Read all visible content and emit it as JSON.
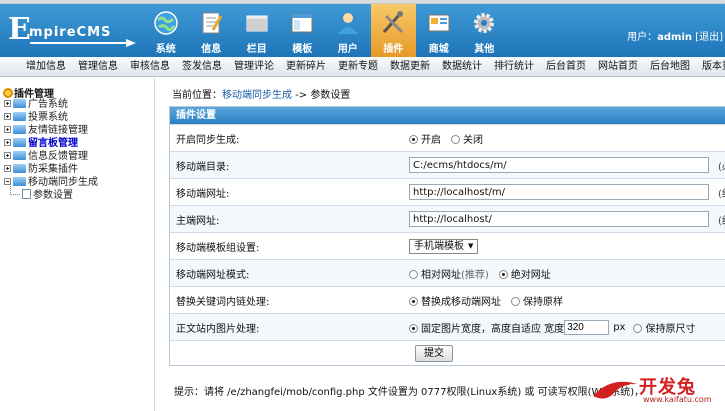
{
  "header": {
    "logo_letter": "E",
    "logo_rest": "mpireCMS",
    "nav": [
      {
        "label": "系统",
        "icon": "globe-icon"
      },
      {
        "label": "信息",
        "icon": "document-icon"
      },
      {
        "label": "栏目",
        "icon": "folder-icon"
      },
      {
        "label": "模板",
        "icon": "template-icon"
      },
      {
        "label": "用户",
        "icon": "user-icon"
      },
      {
        "label": "插件",
        "icon": "plugin-tools-icon",
        "active": true
      },
      {
        "label": "商城",
        "icon": "shop-icon"
      },
      {
        "label": "其他",
        "icon": "gear-icon"
      }
    ],
    "user_prefix": "用户：",
    "user_name": "admin",
    "logout": "[退出]"
  },
  "subnav": [
    "增加信息",
    "管理信息",
    "审核信息",
    "签发信息",
    "管理评论",
    "更新碎片",
    "更新专题",
    "数据更新",
    "数据统计",
    "排行统计",
    "后台首页",
    "网站首页",
    "后台地图",
    "版本更新"
  ],
  "sidebar": {
    "title": "插件管理",
    "nodes": [
      {
        "label": "广告系统"
      },
      {
        "label": "投票系统"
      },
      {
        "label": "友情链接管理"
      },
      {
        "label": "留言板管理",
        "highlight": true
      },
      {
        "label": "信息反馈管理"
      },
      {
        "label": "防采集插件"
      },
      {
        "label": "移动端同步生成",
        "expanded": true
      }
    ],
    "child": "参数设置"
  },
  "main": {
    "crumb_prefix": "当前位置：",
    "crumb_link": "移动端同步生成",
    "crumb_sep": " -> ",
    "crumb_current": "参数设置",
    "table_title": "插件设置",
    "rows": {
      "sync": {
        "label": "开启同步生成:",
        "opt1": "开启",
        "opt2": "关闭"
      },
      "mdir": {
        "label": "移动端目录:",
        "value": "C:/ecms/htdocs/m/",
        "hint": "(必"
      },
      "murl": {
        "label": "移动端网址:",
        "value": "http://localhost/m/",
        "hint": "(结"
      },
      "purl": {
        "label": "主端网址:",
        "value": "http://localhost/",
        "hint": "(结"
      },
      "tpl": {
        "label": "移动端模板组设置:",
        "selected": "手机端模板"
      },
      "urlmode": {
        "label": "移动端网址模式:",
        "opt1": "相对网址",
        "opt1_note": "(推荐)",
        "opt2": "绝对网址"
      },
      "kw": {
        "label": "替换关键词内链处理:",
        "opt1": "替换成移动端网址",
        "opt2": "保持原样"
      },
      "img": {
        "label": "正文站内图片处理:",
        "opt1": "固定图片宽度，高度自适应 宽度",
        "width": "320",
        "unit": "px",
        "opt2": "保持原尺寸"
      }
    },
    "submit": "提交",
    "tip": "提示：请将 /e/zhangfei/mob/config.php 文件设置为 0777权限(Linux系统) 或 可读写权限(Win系统)，"
  },
  "watermark": {
    "text": "开发兔",
    "url": "www.kaifatu.com"
  }
}
